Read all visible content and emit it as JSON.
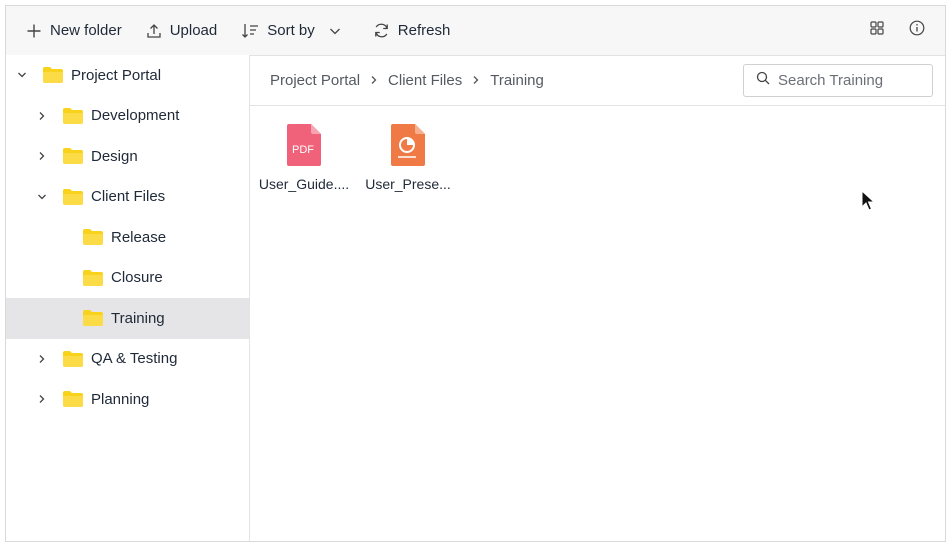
{
  "toolbar": {
    "new_folder": "New folder",
    "upload": "Upload",
    "sort_by": "Sort by",
    "refresh": "Refresh"
  },
  "navigation": {
    "items": [
      {
        "label": "Project Portal",
        "level": 0,
        "expanded": true
      },
      {
        "label": "Development",
        "level": 1,
        "expanded": false
      },
      {
        "label": "Design",
        "level": 1,
        "expanded": false
      },
      {
        "label": "Client Files",
        "level": 1,
        "expanded": true
      },
      {
        "label": "Release",
        "level": 2
      },
      {
        "label": "Closure",
        "level": 2
      },
      {
        "label": "Training",
        "level": 2,
        "selected": true
      },
      {
        "label": "QA & Testing",
        "level": 1,
        "expanded": false
      },
      {
        "label": "Planning",
        "level": 1,
        "expanded": false
      }
    ]
  },
  "breadcrumb": [
    "Project Portal",
    "Client Files",
    "Training"
  ],
  "search": {
    "placeholder": "Search Training"
  },
  "files": [
    {
      "name": "User_Guide....",
      "type": "pdf",
      "icon_label": "PDF",
      "color": "#f0627a"
    },
    {
      "name": "User_Prese...",
      "type": "pptx",
      "color": "#ef7a45"
    }
  ],
  "colors": {
    "folder": "#f9d21c",
    "selected_bg": "#e5e5e8",
    "toolbar_bg": "#f7f7f8"
  }
}
